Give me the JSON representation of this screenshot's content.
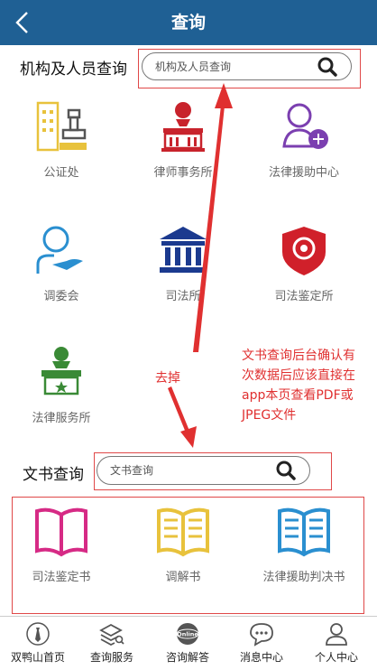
{
  "header": {
    "title": "查询"
  },
  "institutions": {
    "section_title": "机构及人员查询",
    "search_placeholder": "机构及人员查询",
    "items": [
      {
        "label": "公证处",
        "icon": "notary-office-icon",
        "color": "#e8c23c"
      },
      {
        "label": "律师事务所",
        "icon": "law-firm-icon",
        "color": "#c8232c"
      },
      {
        "label": "法律援助中心",
        "icon": "legal-aid-center-icon",
        "color": "#7b3fb0"
      },
      {
        "label": "调委会",
        "icon": "mediation-committee-icon",
        "color": "#2a8fd0"
      },
      {
        "label": "司法所",
        "icon": "judicial-office-icon",
        "color": "#1b3a8f"
      },
      {
        "label": "司法鉴定所",
        "icon": "forensic-appraisal-icon",
        "color": "#d0202a"
      },
      {
        "label": "法律服务所",
        "icon": "legal-service-office-icon",
        "color": "#3a8a36"
      }
    ]
  },
  "documents": {
    "section_title": "文书查询",
    "search_placeholder": "文书查询",
    "items": [
      {
        "label": "司法鉴定书",
        "icon": "book-icon",
        "color": "#d62a85"
      },
      {
        "label": "调解书",
        "icon": "book-icon",
        "color": "#e8c23c"
      },
      {
        "label": "法律援助判决书",
        "icon": "book-icon",
        "color": "#2a8fd0"
      }
    ]
  },
  "annotations": {
    "remove_note": "去掉",
    "backend_note": [
      "文书查询后台确认有",
      "次数据后应该直接在",
      "app本页查看PDF或",
      "JPEG文件"
    ],
    "color": "#e03030"
  },
  "tabbar": {
    "items": [
      {
        "label": "双鸭山首页",
        "icon": "home-tie-icon"
      },
      {
        "label": "查询服务",
        "icon": "search-service-icon"
      },
      {
        "label": "咨询解答",
        "icon": "online-consult-icon",
        "badge": "Online"
      },
      {
        "label": "消息中心",
        "icon": "message-icon"
      },
      {
        "label": "个人中心",
        "icon": "person-icon"
      }
    ]
  },
  "colors": {
    "header_bg": "#1f6094",
    "accent_red": "#e04848"
  }
}
